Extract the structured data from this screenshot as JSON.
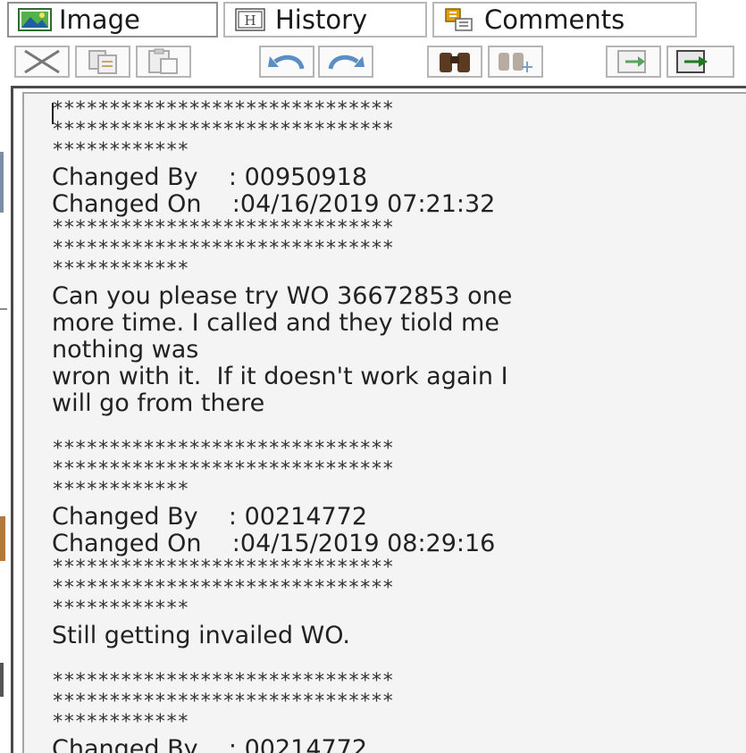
{
  "tabs": [
    {
      "label": "Image",
      "icon": "image-icon",
      "active": true
    },
    {
      "label": "History",
      "icon": "history-icon"
    },
    {
      "label": "Comments",
      "icon": "comments-icon"
    }
  ],
  "toolbar": {
    "buttons": [
      "cut-icon",
      "copy-icon",
      "paste-icon",
      "undo-icon",
      "redo-icon",
      "find-icon",
      "find-next-icon",
      "import-icon",
      "export-icon"
    ]
  },
  "comments": {
    "separator": "******************************",
    "separator_short": "************",
    "entries": [
      {
        "changed_by": "Changed By    : 00950918",
        "changed_on": "Changed On    :04/16/2019 07:21:32",
        "text_lines": [
          "Can you please try WO 36672853 one",
          "more time. I called and they tiold me",
          "nothing was",
          "wron with it.  If it doesn't work again I",
          "will go from there"
        ]
      },
      {
        "changed_by": "Changed By    : 00214772",
        "changed_on": "Changed On    :04/15/2019 08:29:16",
        "text_lines": [
          "Still getting invailed WO."
        ]
      }
    ],
    "partial_line": "Changed By    : 00214772"
  },
  "colors": {
    "panel_bg": "#f4f4f4",
    "border_dark": "#4a4a4a",
    "text": "#222222"
  }
}
